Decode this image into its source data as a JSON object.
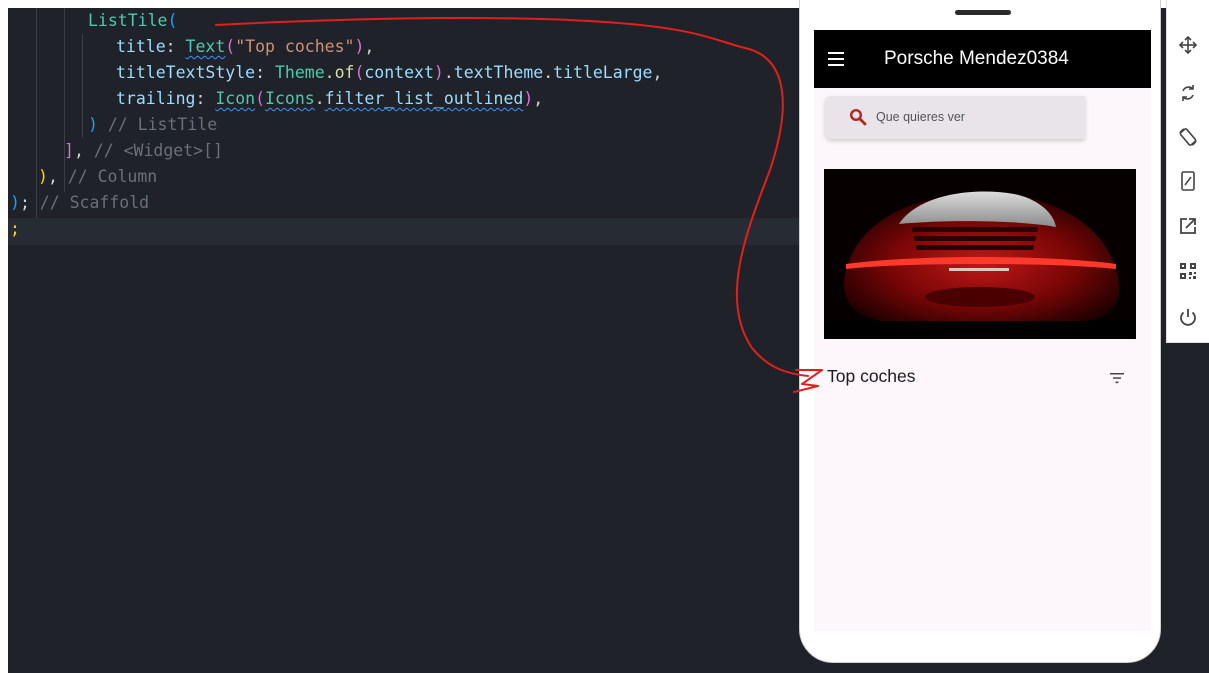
{
  "editor": {
    "lines": [
      {
        "tokens": [
          [
            "c-cls",
            "ListTile"
          ],
          [
            "c-brk3",
            "("
          ]
        ]
      },
      {
        "tokens": [
          [
            "c-prop",
            "title"
          ],
          [
            "c-pun",
            ": "
          ],
          [
            "c-cls",
            "Text"
          ],
          [
            "c-brk2",
            "("
          ],
          [
            "c-str",
            "\"Top coches\""
          ],
          [
            "c-brk2",
            ")"
          ],
          [
            "c-pun",
            ","
          ]
        ]
      },
      {
        "tokens": [
          [
            "c-prop",
            "titleTextStyle"
          ],
          [
            "c-pun",
            ": "
          ],
          [
            "c-cls",
            "Theme"
          ],
          [
            "c-pun",
            "."
          ],
          [
            "c-yel",
            "of"
          ],
          [
            "c-brk2",
            "("
          ],
          [
            "c-prop",
            "context"
          ],
          [
            "c-brk2",
            ")"
          ],
          [
            "c-pun",
            "."
          ],
          [
            "c-prop",
            "textTheme"
          ],
          [
            "c-pun",
            "."
          ],
          [
            "c-prop",
            "titleLarge"
          ],
          [
            "c-pun",
            ","
          ]
        ]
      },
      {
        "tokens": [
          [
            "c-prop",
            "trailing"
          ],
          [
            "c-pun",
            ": "
          ],
          [
            "c-cls",
            "Icon"
          ],
          [
            "c-brk2",
            "("
          ],
          [
            "c-cls",
            "Icons"
          ],
          [
            "c-pun",
            "."
          ],
          [
            "c-prop",
            "filter_list_outlined"
          ],
          [
            "c-brk2",
            ")"
          ],
          [
            "c-pun",
            ","
          ]
        ]
      },
      {
        "tokens": [
          [
            "c-brk3",
            ")"
          ],
          [
            "c-cmt",
            " // ListTile"
          ]
        ]
      },
      {
        "tokens": [
          [
            "c-brk2",
            "]"
          ],
          [
            "c-pun",
            ","
          ],
          [
            "c-cmt",
            " // <Widget>[]"
          ]
        ]
      },
      {
        "tokens": [
          [
            "c-brk1",
            ")"
          ],
          [
            "c-pun",
            ","
          ],
          [
            "c-cmt",
            " // Column"
          ]
        ]
      },
      {
        "tokens": [
          [
            "c-brk3",
            ")"
          ],
          [
            "c-pun",
            ";"
          ],
          [
            "c-cmt",
            " // Scaffold"
          ]
        ]
      },
      {
        "tokens": [
          [
            "c-brk1",
            ";"
          ]
        ]
      }
    ]
  },
  "app": {
    "title": "Porsche Mendez0384",
    "menu_icon": "menu-icon",
    "search": {
      "placeholder": "Que quieres ver",
      "icon": "search-icon"
    },
    "image": {
      "subject": "red-porsche-rear"
    },
    "list_tile": {
      "title": "Top coches",
      "trailing_icon": "filter-list-icon"
    }
  },
  "toolbar": {
    "items": [
      "move-icon",
      "rotate-icon",
      "rotate-device-icon",
      "screen-size-icon",
      "open-external-icon",
      "qr-code-icon",
      "power-icon"
    ]
  },
  "colors": {
    "editor_bg": "#1f2228",
    "appbar_bg": "#000000",
    "screen_bg": "#fdf6fb",
    "annotation": "#e0201b",
    "search_icon": "#b3261e"
  }
}
